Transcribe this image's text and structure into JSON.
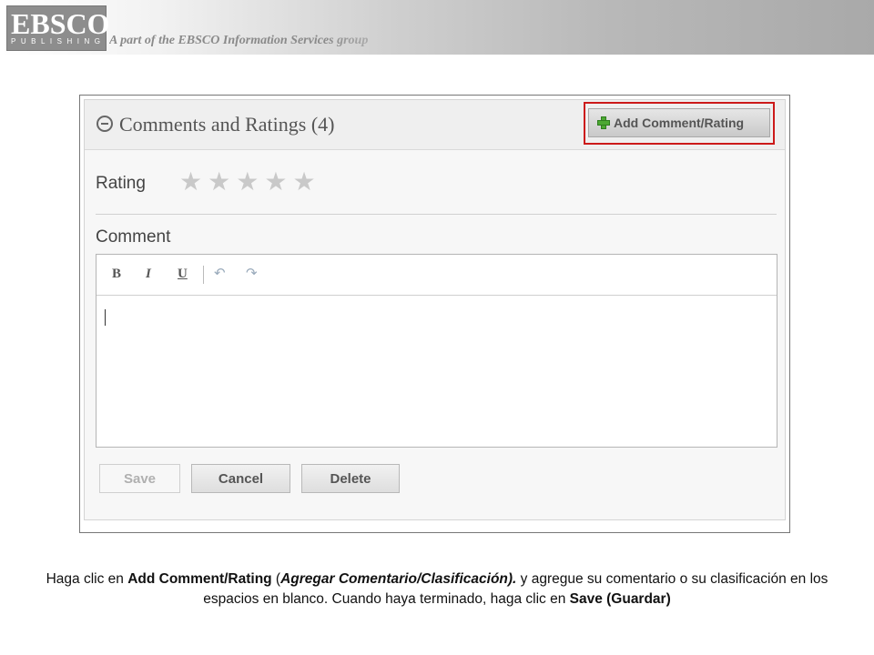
{
  "header": {
    "logo_text": "EBSCO",
    "logo_subtext": "PUBLISHING",
    "tagline": "A part of the EBSCO Information Services group"
  },
  "panel": {
    "title": "Comments and Ratings (4)",
    "add_button_label": "Add Comment/Rating",
    "rating_label": "Rating",
    "stars": [
      "★",
      "★",
      "★",
      "★",
      "★"
    ],
    "comment_label": "Comment",
    "toolbar": {
      "bold": "B",
      "italic": "I",
      "underline": "U",
      "undo": "↶",
      "redo": "↷"
    },
    "comment_value": "",
    "buttons": {
      "save": "Save",
      "cancel": "Cancel",
      "delete": "Delete"
    }
  },
  "caption": {
    "part1": "Haga clic en ",
    "part2": "Add Comment/Rating",
    "part3": " (",
    "part4": "Agregar Comentario/Clasificación).",
    "part5": " y agregue su comentario o su clasificación en los espacios en blanco. Cuando haya terminado, haga clic en ",
    "part6": "Save (Guardar)"
  },
  "colors": {
    "highlight_outline": "#cc1a1a",
    "add_icon": "#4ca832"
  }
}
